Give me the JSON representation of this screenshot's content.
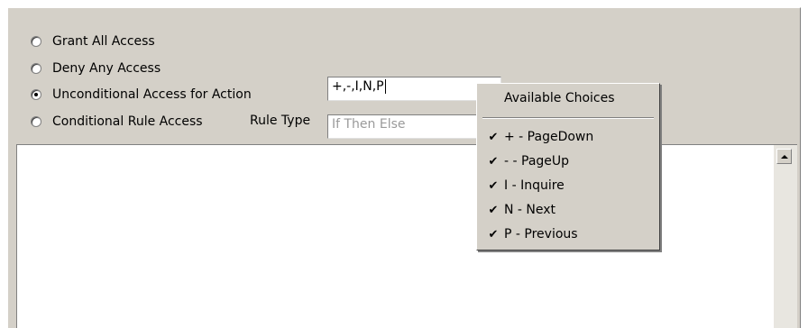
{
  "options": {
    "grant_all": "Grant All Access",
    "deny_any": "Deny Any Access",
    "unconditional": "Unconditional Access for Action",
    "conditional": "Conditional Rule Access"
  },
  "selected_option": "unconditional",
  "action_field": {
    "value": "+,-,I,N,P"
  },
  "rule_type": {
    "label": "Rule Type",
    "value": "If Then Else"
  },
  "popup": {
    "title": "Available Choices",
    "items": [
      {
        "label": "+ - PageDown",
        "checked": true
      },
      {
        "label": "- - PageUp",
        "checked": true
      },
      {
        "label": "I - Inquire",
        "checked": true
      },
      {
        "label": "N - Next",
        "checked": true
      },
      {
        "label": "P - Previous",
        "checked": true
      }
    ]
  },
  "icons": {
    "check": "✔",
    "scroll_up": "scroll-up-arrow"
  }
}
